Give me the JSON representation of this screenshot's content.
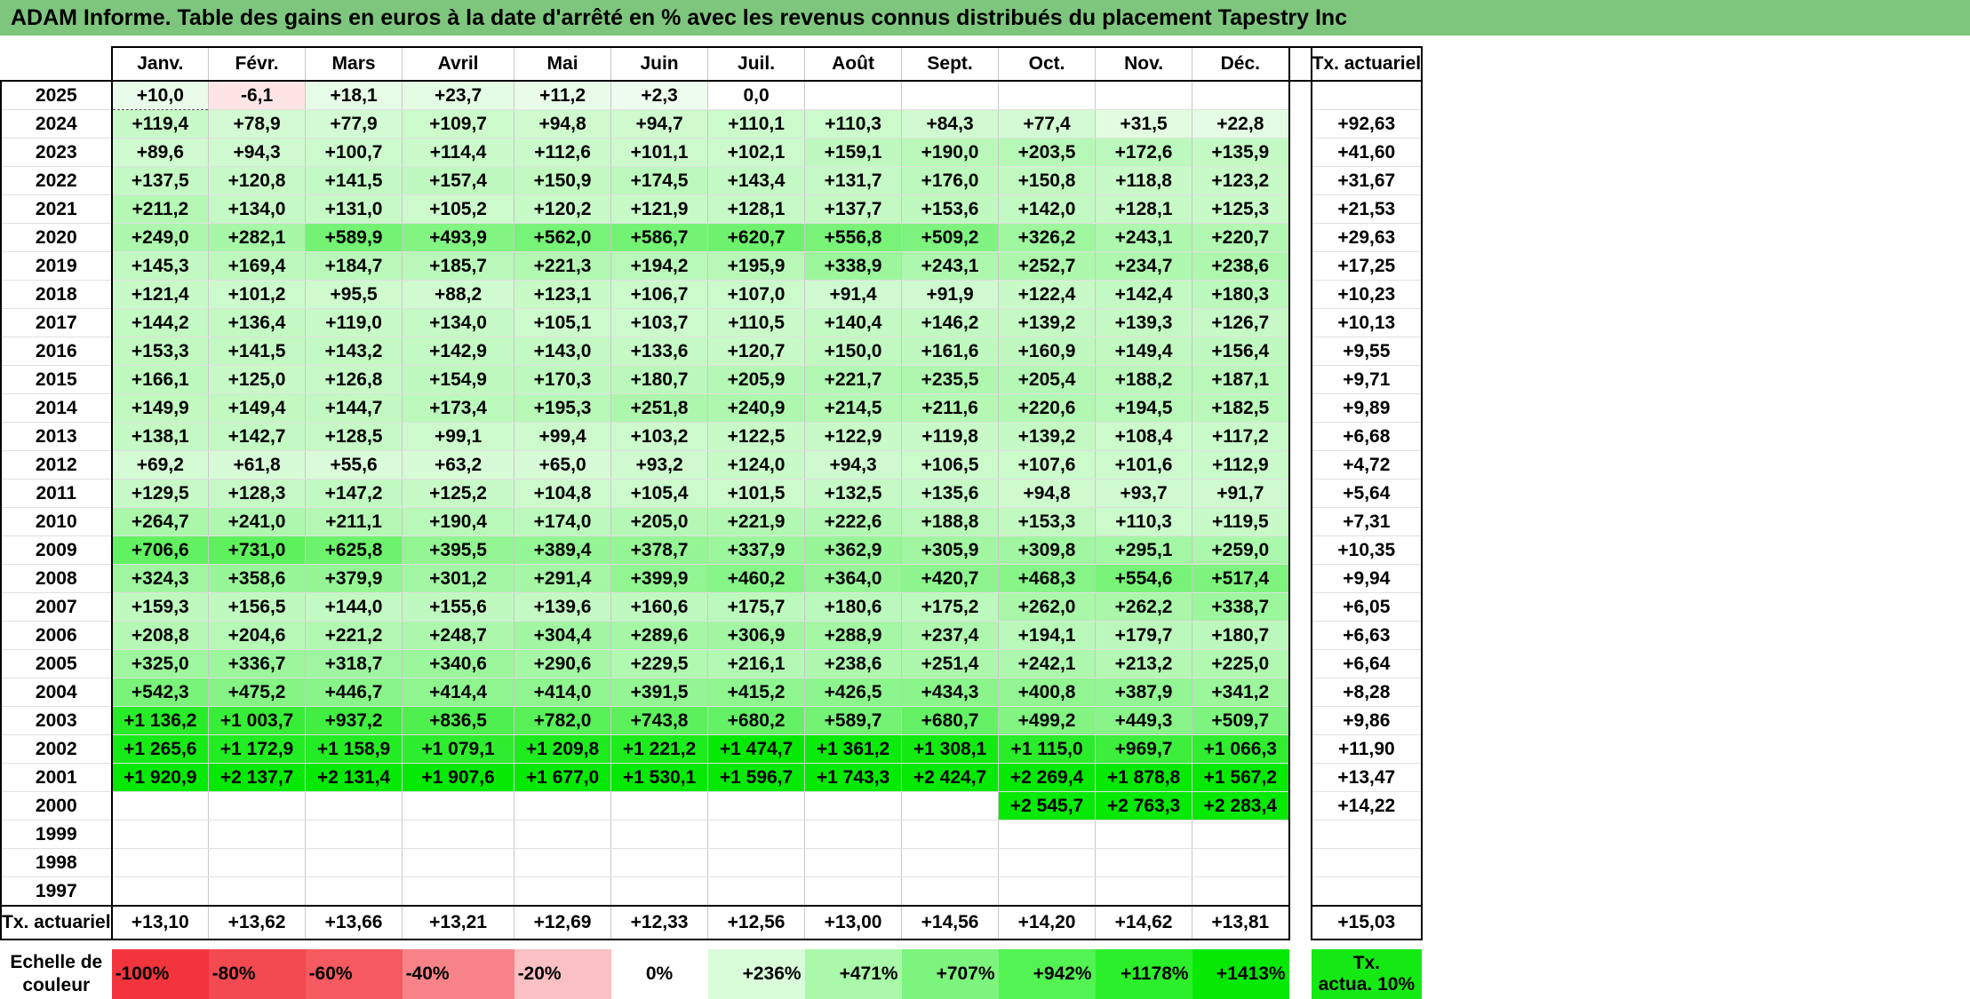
{
  "title": "ADAM Informe. Table des gains en euros à la date d'arrêté en % avec les revenus connus distribués du placement Tapestry Inc",
  "chart_data": {
    "type": "table",
    "columns": [
      "Janv.",
      "Févr.",
      "Mars",
      "Avril",
      "Mai",
      "Juin",
      "Juil.",
      "Août",
      "Sept.",
      "Oct.",
      "Nov.",
      "Déc."
    ],
    "annual_header": "Tx. actuariel",
    "rows": [
      {
        "year": "2025",
        "values": [
          "+10,0",
          "-6,1",
          "+18,1",
          "+23,7",
          "+11,2",
          "+2,3",
          "0,0",
          "",
          "",
          "",
          "",
          ""
        ],
        "annual": ""
      },
      {
        "year": "2024",
        "values": [
          "+119,4",
          "+78,9",
          "+77,9",
          "+109,7",
          "+94,8",
          "+94,7",
          "+110,1",
          "+110,3",
          "+84,3",
          "+77,4",
          "+31,5",
          "+22,8"
        ],
        "annual": "+92,63"
      },
      {
        "year": "2023",
        "values": [
          "+89,6",
          "+94,3",
          "+100,7",
          "+114,4",
          "+112,6",
          "+101,1",
          "+102,1",
          "+159,1",
          "+190,0",
          "+203,5",
          "+172,6",
          "+135,9"
        ],
        "annual": "+41,60"
      },
      {
        "year": "2022",
        "values": [
          "+137,5",
          "+120,8",
          "+141,5",
          "+157,4",
          "+150,9",
          "+174,5",
          "+143,4",
          "+131,7",
          "+176,0",
          "+150,8",
          "+118,8",
          "+123,2"
        ],
        "annual": "+31,67"
      },
      {
        "year": "2021",
        "values": [
          "+211,2",
          "+134,0",
          "+131,0",
          "+105,2",
          "+120,2",
          "+121,9",
          "+128,1",
          "+137,7",
          "+153,6",
          "+142,0",
          "+128,1",
          "+125,3"
        ],
        "annual": "+21,53"
      },
      {
        "year": "2020",
        "values": [
          "+249,0",
          "+282,1",
          "+589,9",
          "+493,9",
          "+562,0",
          "+586,7",
          "+620,7",
          "+556,8",
          "+509,2",
          "+326,2",
          "+243,1",
          "+220,7"
        ],
        "annual": "+29,63"
      },
      {
        "year": "2019",
        "values": [
          "+145,3",
          "+169,4",
          "+184,7",
          "+185,7",
          "+221,3",
          "+194,2",
          "+195,9",
          "+338,9",
          "+243,1",
          "+252,7",
          "+234,7",
          "+238,6"
        ],
        "annual": "+17,25"
      },
      {
        "year": "2018",
        "values": [
          "+121,4",
          "+101,2",
          "+95,5",
          "+88,2",
          "+123,1",
          "+106,7",
          "+107,0",
          "+91,4",
          "+91,9",
          "+122,4",
          "+142,4",
          "+180,3"
        ],
        "annual": "+10,23"
      },
      {
        "year": "2017",
        "values": [
          "+144,2",
          "+136,4",
          "+119,0",
          "+134,0",
          "+105,1",
          "+103,7",
          "+110,5",
          "+140,4",
          "+146,2",
          "+139,2",
          "+139,3",
          "+126,7"
        ],
        "annual": "+10,13"
      },
      {
        "year": "2016",
        "values": [
          "+153,3",
          "+141,5",
          "+143,2",
          "+142,9",
          "+143,0",
          "+133,6",
          "+120,7",
          "+150,0",
          "+161,6",
          "+160,9",
          "+149,4",
          "+156,4"
        ],
        "annual": "+9,55"
      },
      {
        "year": "2015",
        "values": [
          "+166,1",
          "+125,0",
          "+126,8",
          "+154,9",
          "+170,3",
          "+180,7",
          "+205,9",
          "+221,7",
          "+235,5",
          "+205,4",
          "+188,2",
          "+187,1"
        ],
        "annual": "+9,71"
      },
      {
        "year": "2014",
        "values": [
          "+149,9",
          "+149,4",
          "+144,7",
          "+173,4",
          "+195,3",
          "+251,8",
          "+240,9",
          "+214,5",
          "+211,6",
          "+220,6",
          "+194,5",
          "+182,5"
        ],
        "annual": "+9,89"
      },
      {
        "year": "2013",
        "values": [
          "+138,1",
          "+142,7",
          "+128,5",
          "+99,1",
          "+99,4",
          "+103,2",
          "+122,5",
          "+122,9",
          "+119,8",
          "+139,2",
          "+108,4",
          "+117,2"
        ],
        "annual": "+6,68"
      },
      {
        "year": "2012",
        "values": [
          "+69,2",
          "+61,8",
          "+55,6",
          "+63,2",
          "+65,0",
          "+93,2",
          "+124,0",
          "+94,3",
          "+106,5",
          "+107,6",
          "+101,6",
          "+112,9"
        ],
        "annual": "+4,72"
      },
      {
        "year": "2011",
        "values": [
          "+129,5",
          "+128,3",
          "+147,2",
          "+125,2",
          "+104,8",
          "+105,4",
          "+101,5",
          "+132,5",
          "+135,6",
          "+94,8",
          "+93,7",
          "+91,7"
        ],
        "annual": "+5,64"
      },
      {
        "year": "2010",
        "values": [
          "+264,7",
          "+241,0",
          "+211,1",
          "+190,4",
          "+174,0",
          "+205,0",
          "+221,9",
          "+222,6",
          "+188,8",
          "+153,3",
          "+110,3",
          "+119,5"
        ],
        "annual": "+7,31"
      },
      {
        "year": "2009",
        "values": [
          "+706,6",
          "+731,0",
          "+625,8",
          "+395,5",
          "+389,4",
          "+378,7",
          "+337,9",
          "+362,9",
          "+305,9",
          "+309,8",
          "+295,1",
          "+259,0"
        ],
        "annual": "+10,35"
      },
      {
        "year": "2008",
        "values": [
          "+324,3",
          "+358,6",
          "+379,9",
          "+301,2",
          "+291,4",
          "+399,9",
          "+460,2",
          "+364,0",
          "+420,7",
          "+468,3",
          "+554,6",
          "+517,4"
        ],
        "annual": "+9,94"
      },
      {
        "year": "2007",
        "values": [
          "+159,3",
          "+156,5",
          "+144,0",
          "+155,6",
          "+139,6",
          "+160,6",
          "+175,7",
          "+180,6",
          "+175,2",
          "+262,0",
          "+262,2",
          "+338,7"
        ],
        "annual": "+6,05"
      },
      {
        "year": "2006",
        "values": [
          "+208,8",
          "+204,6",
          "+221,2",
          "+248,7",
          "+304,4",
          "+289,6",
          "+306,9",
          "+288,9",
          "+237,4",
          "+194,1",
          "+179,7",
          "+180,7"
        ],
        "annual": "+6,63"
      },
      {
        "year": "2005",
        "values": [
          "+325,0",
          "+336,7",
          "+318,7",
          "+340,6",
          "+290,6",
          "+229,5",
          "+216,1",
          "+238,6",
          "+251,4",
          "+242,1",
          "+213,2",
          "+225,0"
        ],
        "annual": "+6,64"
      },
      {
        "year": "2004",
        "values": [
          "+542,3",
          "+475,2",
          "+446,7",
          "+414,4",
          "+414,0",
          "+391,5",
          "+415,2",
          "+426,5",
          "+434,3",
          "+400,8",
          "+387,9",
          "+341,2"
        ],
        "annual": "+8,28"
      },
      {
        "year": "2003",
        "values": [
          "+1 136,2",
          "+1 003,7",
          "+937,2",
          "+836,5",
          "+782,0",
          "+743,8",
          "+680,2",
          "+589,7",
          "+680,7",
          "+499,2",
          "+449,3",
          "+509,7"
        ],
        "annual": "+9,86"
      },
      {
        "year": "2002",
        "values": [
          "+1 265,6",
          "+1 172,9",
          "+1 158,9",
          "+1 079,1",
          "+1 209,8",
          "+1 221,2",
          "+1 474,7",
          "+1 361,2",
          "+1 308,1",
          "+1 115,0",
          "+969,7",
          "+1 066,3"
        ],
        "annual": "+11,90"
      },
      {
        "year": "2001",
        "values": [
          "+1 920,9",
          "+2 137,7",
          "+2 131,4",
          "+1 907,6",
          "+1 677,0",
          "+1 530,1",
          "+1 596,7",
          "+1 743,3",
          "+2 424,7",
          "+2 269,4",
          "+1 878,8",
          "+1 567,2"
        ],
        "annual": "+13,47"
      },
      {
        "year": "2000",
        "values": [
          "",
          "",
          "",
          "",
          "",
          "",
          "",
          "",
          "",
          "+2 545,7",
          "+2 763,3",
          "+2 283,4"
        ],
        "annual": "+14,22"
      },
      {
        "year": "1999",
        "values": [
          "",
          "",
          "",
          "",
          "",
          "",
          "",
          "",
          "",
          "",
          "",
          ""
        ],
        "annual": ""
      },
      {
        "year": "1998",
        "values": [
          "",
          "",
          "",
          "",
          "",
          "",
          "",
          "",
          "",
          "",
          "",
          ""
        ],
        "annual": ""
      },
      {
        "year": "1997",
        "values": [
          "",
          "",
          "",
          "",
          "",
          "",
          "",
          "",
          "",
          "",
          "",
          ""
        ],
        "annual": ""
      }
    ],
    "totals_label": "Tx. actuariel",
    "totals": [
      "+13,10",
      "+13,62",
      "+13,66",
      "+13,21",
      "+12,69",
      "+12,33",
      "+12,56",
      "+13,00",
      "+14,56",
      "+14,20",
      "+14,62",
      "+13,81"
    ],
    "totals_annual": "+15,03",
    "scale_label_1": "Echelle de",
    "scale_label_2": "couleur",
    "scale": [
      {
        "label": "-100%",
        "color": "#f2353c"
      },
      {
        "label": "-80%",
        "color": "#f34950"
      },
      {
        "label": "-60%",
        "color": "#f45a60"
      },
      {
        "label": "-40%",
        "color": "#f78389"
      },
      {
        "label": "-20%",
        "color": "#fac0c3"
      },
      {
        "label": "0%",
        "color": "#ffffff"
      },
      {
        "label": "+236%",
        "color": "#d9fcd9"
      },
      {
        "label": "+471%",
        "color": "#aaf8aa"
      },
      {
        "label": "+707%",
        "color": "#7df47d"
      },
      {
        "label": "+942%",
        "color": "#52f352"
      },
      {
        "label": "+1178%",
        "color": "#2bef2b"
      },
      {
        "label": "+1413%",
        "color": "#05e905"
      }
    ],
    "scale_annual_1": "Tx.",
    "scale_annual_2": "actua. 10%",
    "scale_annual_color": "#14e914"
  }
}
